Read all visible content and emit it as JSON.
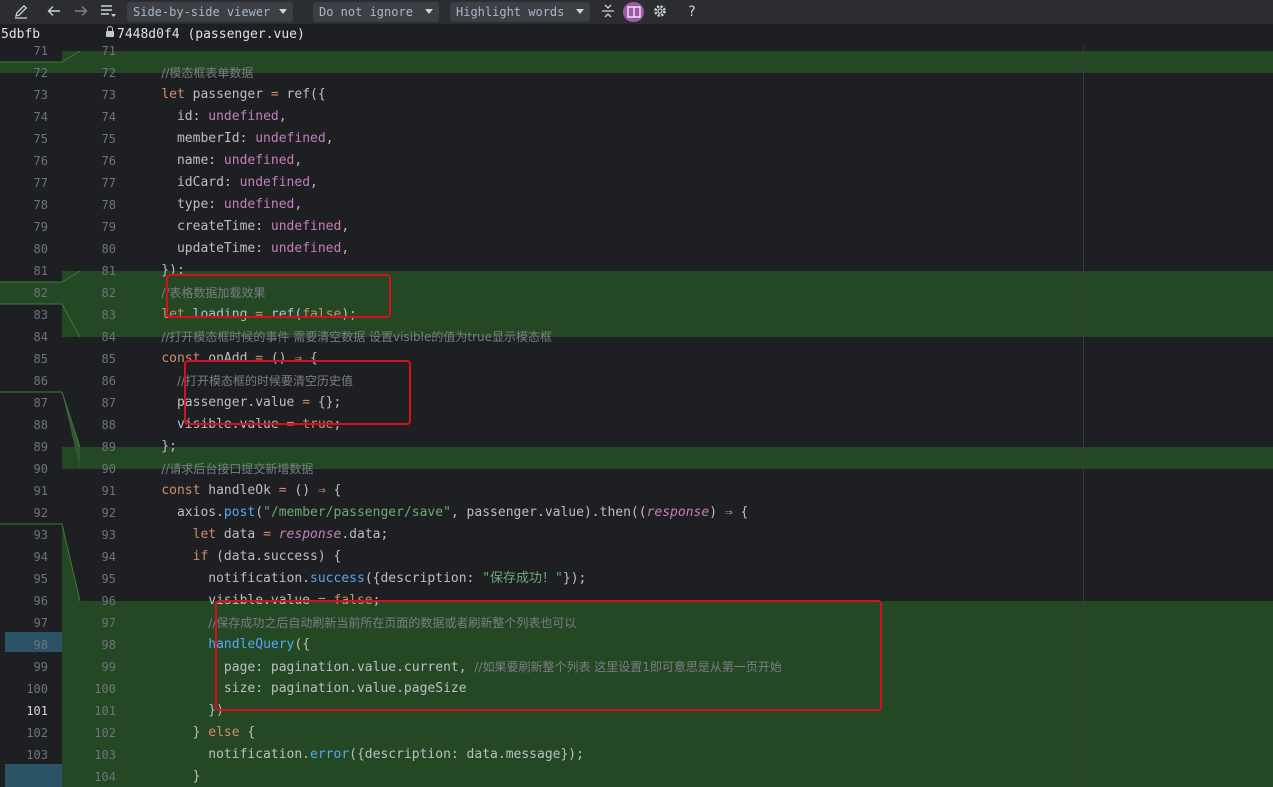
{
  "toolbar": {
    "viewer_mode": "Side-by-side viewer",
    "ignore_mode": "Do not ignore",
    "highlight_mode": "Highlight words",
    "help_label": "?"
  },
  "files": {
    "left_revision": "5dbfb",
    "right_title": "7448d0f4 (passenger.vue)"
  },
  "left_line_numbers": [
    "71",
    "72",
    "73",
    "74",
    "75",
    "76",
    "77",
    "78",
    "79",
    "80",
    "81",
    "82",
    "83",
    "84",
    "85",
    "86",
    "87",
    "88",
    "89",
    "90",
    "91",
    "92",
    "93",
    "94",
    "95",
    "96",
    "97",
    "98",
    "99",
    "100",
    "101",
    "102",
    "103"
  ],
  "left_current_line": "101",
  "right_line_numbers": [
    "71",
    "72",
    "73",
    "74",
    "75",
    "76",
    "77",
    "78",
    "79",
    "80",
    "81",
    "82",
    "83",
    "84",
    "85",
    "86",
    "87",
    "88",
    "89",
    "90",
    "91",
    "92",
    "93",
    "94",
    "95",
    "96",
    "97",
    "98",
    "99",
    "100",
    "101",
    "102",
    "103",
    "104"
  ],
  "code_lines": [
    [
      {
        "t": "",
        "c": ""
      }
    ],
    [
      {
        "t": "    ",
        "c": ""
      },
      {
        "t": "//模态框表单数据",
        "c": "cmz"
      }
    ],
    [
      {
        "t": "    ",
        "c": ""
      },
      {
        "t": "let",
        "c": "kw"
      },
      {
        "t": " passenger ",
        "c": ""
      },
      {
        "t": "=",
        "c": "kw"
      },
      {
        "t": " ref({",
        "c": ""
      }
    ],
    [
      {
        "t": "      id: ",
        "c": ""
      },
      {
        "t": "undefined",
        "c": "un"
      },
      {
        "t": ",",
        "c": ""
      }
    ],
    [
      {
        "t": "      memberId: ",
        "c": ""
      },
      {
        "t": "undefined",
        "c": "un"
      },
      {
        "t": ",",
        "c": ""
      }
    ],
    [
      {
        "t": "      name: ",
        "c": ""
      },
      {
        "t": "undefined",
        "c": "un"
      },
      {
        "t": ",",
        "c": ""
      }
    ],
    [
      {
        "t": "      idCard: ",
        "c": ""
      },
      {
        "t": "undefined",
        "c": "un"
      },
      {
        "t": ",",
        "c": ""
      }
    ],
    [
      {
        "t": "      type: ",
        "c": ""
      },
      {
        "t": "undefined",
        "c": "un"
      },
      {
        "t": ",",
        "c": ""
      }
    ],
    [
      {
        "t": "      createTime: ",
        "c": ""
      },
      {
        "t": "undefined",
        "c": "un"
      },
      {
        "t": ",",
        "c": ""
      }
    ],
    [
      {
        "t": "      updateTime: ",
        "c": ""
      },
      {
        "t": "undefined",
        "c": "un"
      },
      {
        "t": ",",
        "c": ""
      }
    ],
    [
      {
        "t": "    });",
        "c": ""
      }
    ],
    [
      {
        "t": "    ",
        "c": ""
      },
      {
        "t": "//表格数据加载效果",
        "c": "cmz"
      }
    ],
    [
      {
        "t": "    ",
        "c": ""
      },
      {
        "t": "let",
        "c": "kw"
      },
      {
        "t": " loading ",
        "c": ""
      },
      {
        "t": "=",
        "c": "kw"
      },
      {
        "t": " ref(",
        "c": ""
      },
      {
        "t": "false",
        "c": "kw"
      },
      {
        "t": ");",
        "c": ""
      }
    ],
    [
      {
        "t": "    ",
        "c": ""
      },
      {
        "t": "//打开模态框时候的事件 需要清空数据 设置visible的值为true显示模态框",
        "c": "cmz"
      }
    ],
    [
      {
        "t": "    ",
        "c": ""
      },
      {
        "t": "const",
        "c": "kw"
      },
      {
        "t": " onAdd ",
        "c": ""
      },
      {
        "t": "=",
        "c": "kw"
      },
      {
        "t": " () ",
        "c": ""
      },
      {
        "t": "⇒",
        "c": "kw"
      },
      {
        "t": " {",
        "c": ""
      }
    ],
    [
      {
        "t": "      ",
        "c": ""
      },
      {
        "t": "//打开模态框的时候要清空历史值",
        "c": "cmz"
      }
    ],
    [
      {
        "t": "      passenger.value ",
        "c": ""
      },
      {
        "t": "=",
        "c": "kw"
      },
      {
        "t": " {};",
        "c": ""
      }
    ],
    [
      {
        "t": "      visible.value ",
        "c": ""
      },
      {
        "t": "=",
        "c": "kw"
      },
      {
        "t": " ",
        "c": ""
      },
      {
        "t": "true",
        "c": "kw"
      },
      {
        "t": ";",
        "c": ""
      }
    ],
    [
      {
        "t": "    };",
        "c": ""
      }
    ],
    [
      {
        "t": "    ",
        "c": ""
      },
      {
        "t": "//请求后台接口提交新增数据",
        "c": "cmz"
      }
    ],
    [
      {
        "t": "    ",
        "c": ""
      },
      {
        "t": "const",
        "c": "kw"
      },
      {
        "t": " handleOk ",
        "c": ""
      },
      {
        "t": "=",
        "c": "kw"
      },
      {
        "t": " () ",
        "c": ""
      },
      {
        "t": "⇒",
        "c": "kw"
      },
      {
        "t": " {",
        "c": ""
      }
    ],
    [
      {
        "t": "      axios.",
        "c": ""
      },
      {
        "t": "post",
        "c": "fn"
      },
      {
        "t": "(",
        "c": ""
      },
      {
        "t": "\"/member/passenger/save\"",
        "c": "str"
      },
      {
        "t": ", passenger.value).then((",
        "c": ""
      },
      {
        "t": "response",
        "c": "pr"
      },
      {
        "t": ") ",
        "c": ""
      },
      {
        "t": "⇒",
        "c": "kw"
      },
      {
        "t": " {",
        "c": ""
      }
    ],
    [
      {
        "t": "        ",
        "c": ""
      },
      {
        "t": "let",
        "c": "kw"
      },
      {
        "t": " data ",
        "c": ""
      },
      {
        "t": "=",
        "c": "kw"
      },
      {
        "t": " ",
        "c": ""
      },
      {
        "t": "response",
        "c": "pr"
      },
      {
        "t": ".data;",
        "c": ""
      }
    ],
    [
      {
        "t": "        ",
        "c": ""
      },
      {
        "t": "if",
        "c": "kw"
      },
      {
        "t": " (data.success) {",
        "c": ""
      }
    ],
    [
      {
        "t": "          notification.",
        "c": ""
      },
      {
        "t": "success",
        "c": "fn"
      },
      {
        "t": "({description: ",
        "c": ""
      },
      {
        "t": "\"保存成功！\"",
        "c": "str"
      },
      {
        "t": "});",
        "c": ""
      }
    ],
    [
      {
        "t": "          visible.value ",
        "c": ""
      },
      {
        "t": "=",
        "c": "kw"
      },
      {
        "t": " ",
        "c": ""
      },
      {
        "t": "false",
        "c": "kw"
      },
      {
        "t": ";",
        "c": ""
      }
    ],
    [
      {
        "t": "          ",
        "c": ""
      },
      {
        "t": "//保存成功之后自动刷新当前所在页面的数据或者刷新整个列表也可以",
        "c": "cmz"
      }
    ],
    [
      {
        "t": "          ",
        "c": ""
      },
      {
        "t": "handleQuery",
        "c": "fn"
      },
      {
        "t": "({",
        "c": ""
      }
    ],
    [
      {
        "t": "            page: pagination.value.current, ",
        "c": ""
      },
      {
        "t": "//如果要刷新整个列表 这里设置1即可意思是从第一页开始",
        "c": "cmz"
      }
    ],
    [
      {
        "t": "            size: pagination.value.pageSize",
        "c": ""
      }
    ],
    [
      {
        "t": "          })",
        "c": ""
      }
    ],
    [
      {
        "t": "        } ",
        "c": ""
      },
      {
        "t": "else",
        "c": "kw"
      },
      {
        "t": " {",
        "c": ""
      }
    ],
    [
      {
        "t": "          notification.",
        "c": ""
      },
      {
        "t": "error",
        "c": "fn"
      },
      {
        "t": "({description: data.message});",
        "c": ""
      }
    ],
    [
      {
        "t": "        }",
        "c": ""
      }
    ]
  ]
}
